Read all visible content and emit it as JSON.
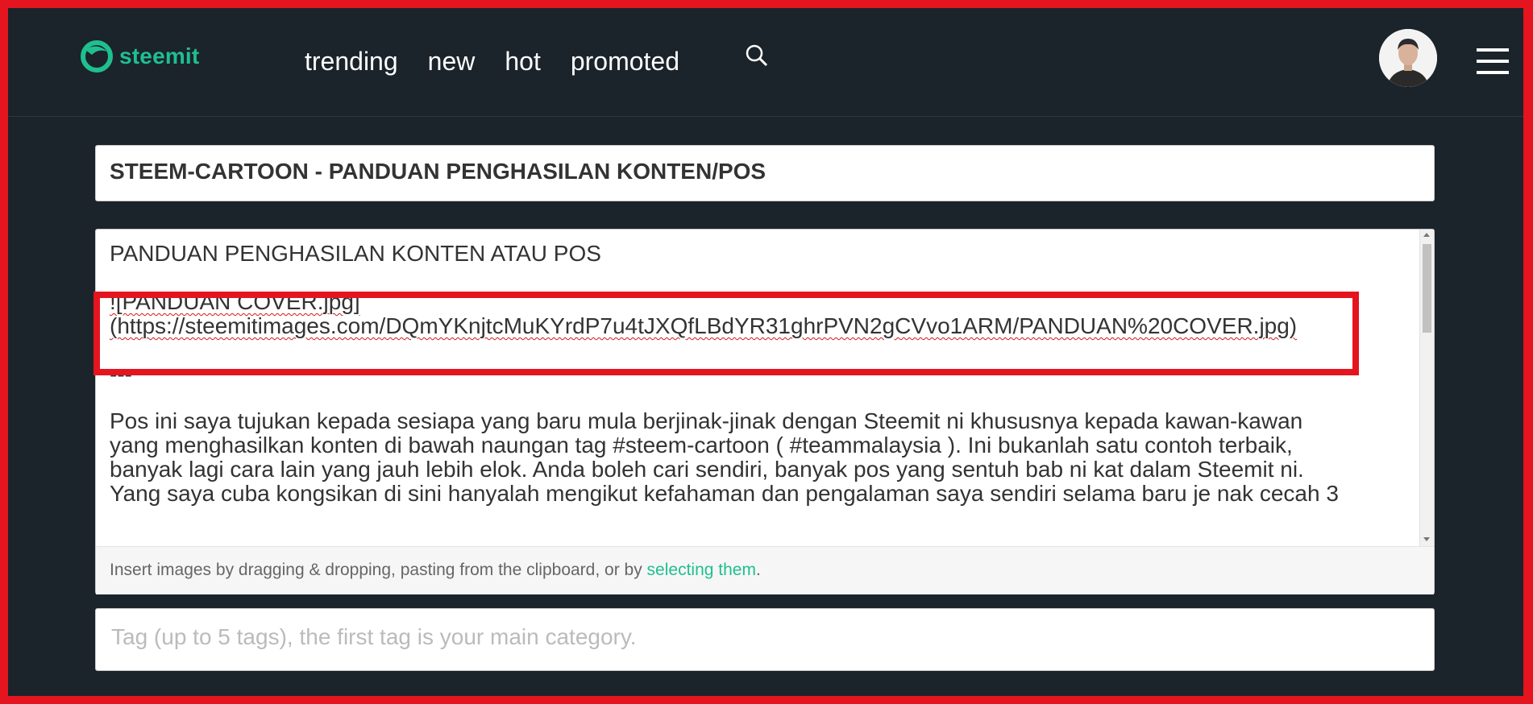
{
  "header": {
    "logo_text": "steemit",
    "nav": [
      "trending",
      "new",
      "hot",
      "promoted"
    ],
    "icons": {
      "search": "search-icon",
      "avatar": "user-avatar",
      "menu": "hamburger-menu-icon"
    }
  },
  "post": {
    "title": "STEEM-CARTOON - PANDUAN PENGHASILAN KONTEN/POS",
    "body_lines": [
      "PANDUAN PENGHASILAN KONTEN ATAU POS",
      "![PANDUAN COVER.jpg]",
      "(https://steemitimages.com/DQmYKnjtcMuKYrdP7u4tJXQfLBdYR31ghrPVN2gCVvo1ARM/PANDUAN%20COVER.jpg)",
      "---",
      "Pos ini saya tujukan kepada sesiapa yang baru mula berjinak-jinak  dengan Steemit ni khususnya kepada kawan-kawan",
      "yang menghasilkan konten di bawah naungan tag #steem-cartoon ( #teammalaysia ). Ini bukanlah satu contoh terbaik,",
      "banyak lagi cara lain yang jauh lebih elok. Anda boleh cari sendiri, banyak pos yang sentuh bab ni kat dalam Steemit ni.",
      "Yang saya cuba kongsikan di sini hanyalah mengikut kefahaman dan pengalaman saya sendiri selama baru je nak cecah 3"
    ],
    "footer_text": "Insert images by dragging & dropping, pasting from the clipboard, or by ",
    "footer_link": "selecting them",
    "footer_end": ".",
    "tag_placeholder": "Tag (up to 5 tags), the first tag is your main category."
  },
  "colors": {
    "frame": "#e4151f",
    "bg": "#1b232b",
    "brand": "#1fbf8f"
  }
}
